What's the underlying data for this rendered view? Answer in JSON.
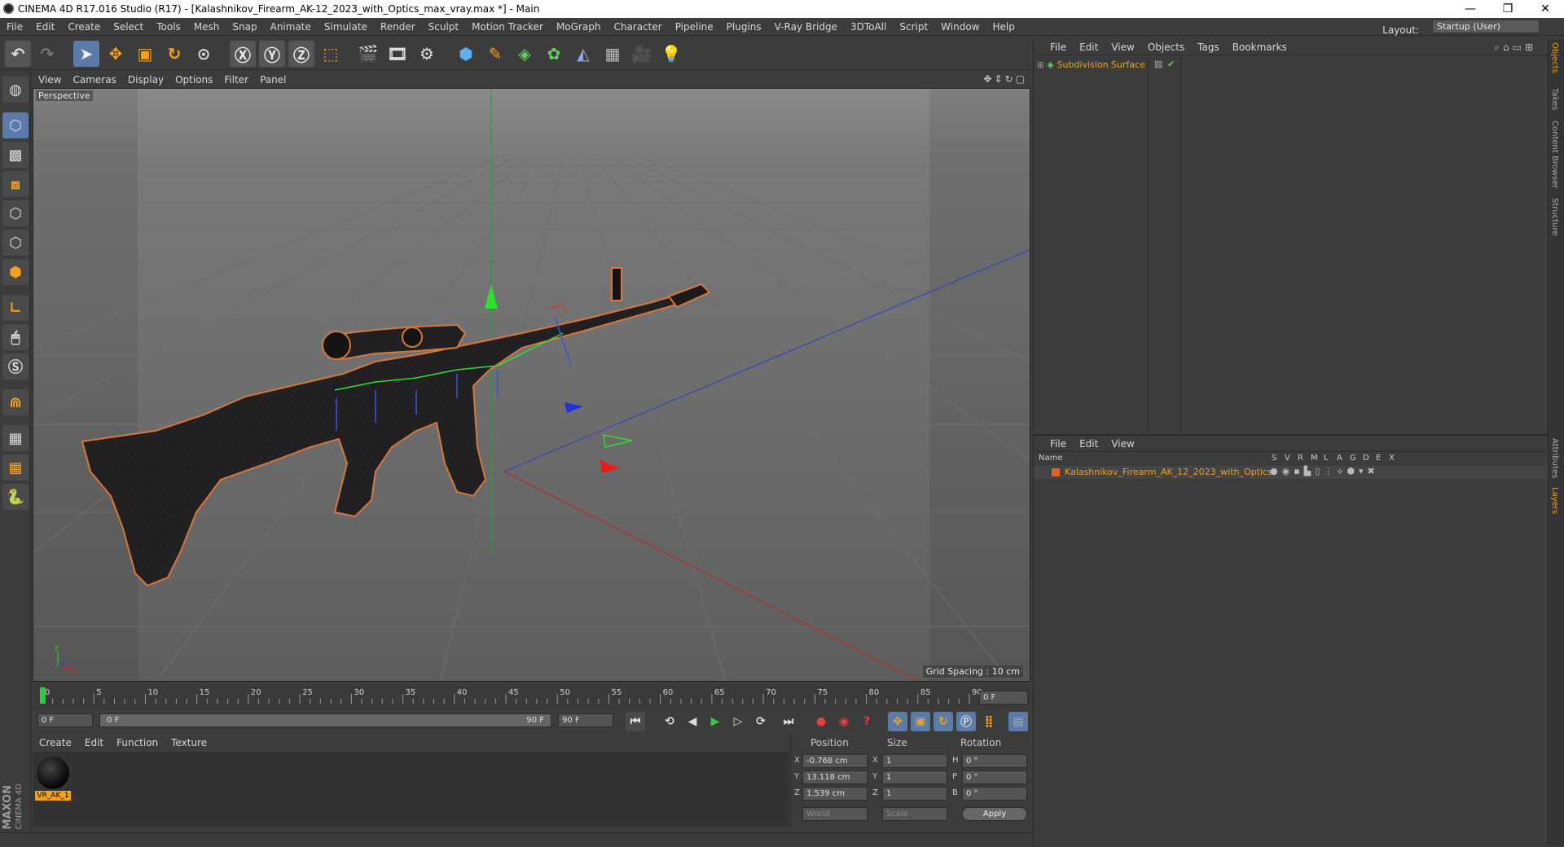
{
  "window": {
    "title": "CINEMA 4D R17.016 Studio (R17) - [Kalashnikov_Firearm_AK-12_2023_with_Optics_max_vray.max *] - Main",
    "minimize": "—",
    "restore": "❐",
    "close": "✕"
  },
  "menubar": {
    "items": [
      "File",
      "Edit",
      "Create",
      "Select",
      "Tools",
      "Mesh",
      "Snap",
      "Animate",
      "Simulate",
      "Render",
      "Sculpt",
      "Motion Tracker",
      "MoGraph",
      "Character",
      "Pipeline",
      "Plugins",
      "V-Ray Bridge",
      "3DToAll",
      "Script",
      "Window",
      "Help"
    ],
    "layout_label": "Layout:",
    "layout_value": "Startup (User)"
  },
  "viewport": {
    "menu": [
      "View",
      "Cameras",
      "Display",
      "Options",
      "Filter",
      "Panel"
    ],
    "label": "Perspective",
    "grid_spacing": "Grid Spacing : 10 cm"
  },
  "timeline": {
    "ticks": [
      "0",
      "5",
      "10",
      "15",
      "20",
      "25",
      "30",
      "35",
      "40",
      "45",
      "50",
      "55",
      "60",
      "65",
      "70",
      "75",
      "80",
      "85",
      "90"
    ],
    "current_frame": "0 F",
    "start_field": "0 F",
    "range_start": "0 F",
    "range_end": "90 F",
    "end_field": "90 F"
  },
  "materials": {
    "menu": [
      "Create",
      "Edit",
      "Function",
      "Texture"
    ],
    "items": [
      {
        "name": "VR_AK_1"
      }
    ]
  },
  "coords": {
    "headers": [
      "Position",
      "Size",
      "Rotation"
    ],
    "rows": [
      {
        "axis": "X",
        "pos": "-0.768 cm",
        "saxis": "X",
        "size": "1",
        "raxis": "H",
        "rot": "0 °"
      },
      {
        "axis": "Y",
        "pos": "13.118 cm",
        "saxis": "Y",
        "size": "1",
        "raxis": "P",
        "rot": "0 °"
      },
      {
        "axis": "Z",
        "pos": "1.539 cm",
        "saxis": "Z",
        "size": "1",
        "raxis": "B",
        "rot": "0 °"
      }
    ],
    "mode": "World",
    "scale": "Scale",
    "apply": "Apply"
  },
  "objects_panel": {
    "menu": [
      "File",
      "Edit",
      "View",
      "Objects",
      "Tags",
      "Bookmarks"
    ],
    "items": [
      {
        "name": "Subdivision Surface"
      }
    ]
  },
  "layers_panel": {
    "menu": [
      "File",
      "Edit",
      "View"
    ],
    "col_name": "Name",
    "cols": [
      "S",
      "V",
      "R",
      "M",
      "L",
      "A",
      "G",
      "D",
      "E",
      "X"
    ],
    "items": [
      {
        "name": "Kalashnikov_Firearm_AK_12_2023_with_Optics",
        "color": "#e0641e"
      }
    ]
  },
  "side_tabs": [
    "Objects",
    "Takes",
    "Content Browser",
    "Structure",
    "Attributes",
    "Layers"
  ],
  "branding": {
    "line1": "MAXON",
    "line2": "CINEMA 4D"
  },
  "colors": {
    "accent": "#f5a11c",
    "selected_text": "#f0a020",
    "active_play": "#2ecc40"
  }
}
